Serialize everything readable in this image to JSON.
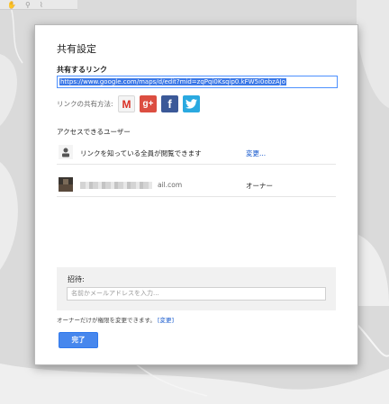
{
  "dialog": {
    "title": "共有設定",
    "link_label": "共有するリンク",
    "link_url": "https://www.google.com/maps/d/edit?mid=zqPqi0Ksqip0.kFW5i0obzAJo",
    "share_label": "リンクの共有方法:",
    "share_icons": [
      "gmail-icon",
      "google-plus-icon",
      "facebook-icon",
      "twitter-icon"
    ],
    "access_label": "アクセスできるユーザー",
    "access_rows": [
      {
        "text": "リンクを知っている全員が閲覧できます",
        "action": "変更..."
      },
      {
        "email_suffix": "ail.com",
        "role": "オーナー"
      }
    ],
    "invite": {
      "label": "招待:",
      "placeholder": "名前かメールアドレスを入力..."
    },
    "note_prefix": "オーナーだけが権限を変更できます。",
    "note_link": "[変更]",
    "done_label": "完了"
  },
  "colors": {
    "accent": "#4787ed",
    "link": "#1155cc",
    "selection": "#3b78e7"
  }
}
